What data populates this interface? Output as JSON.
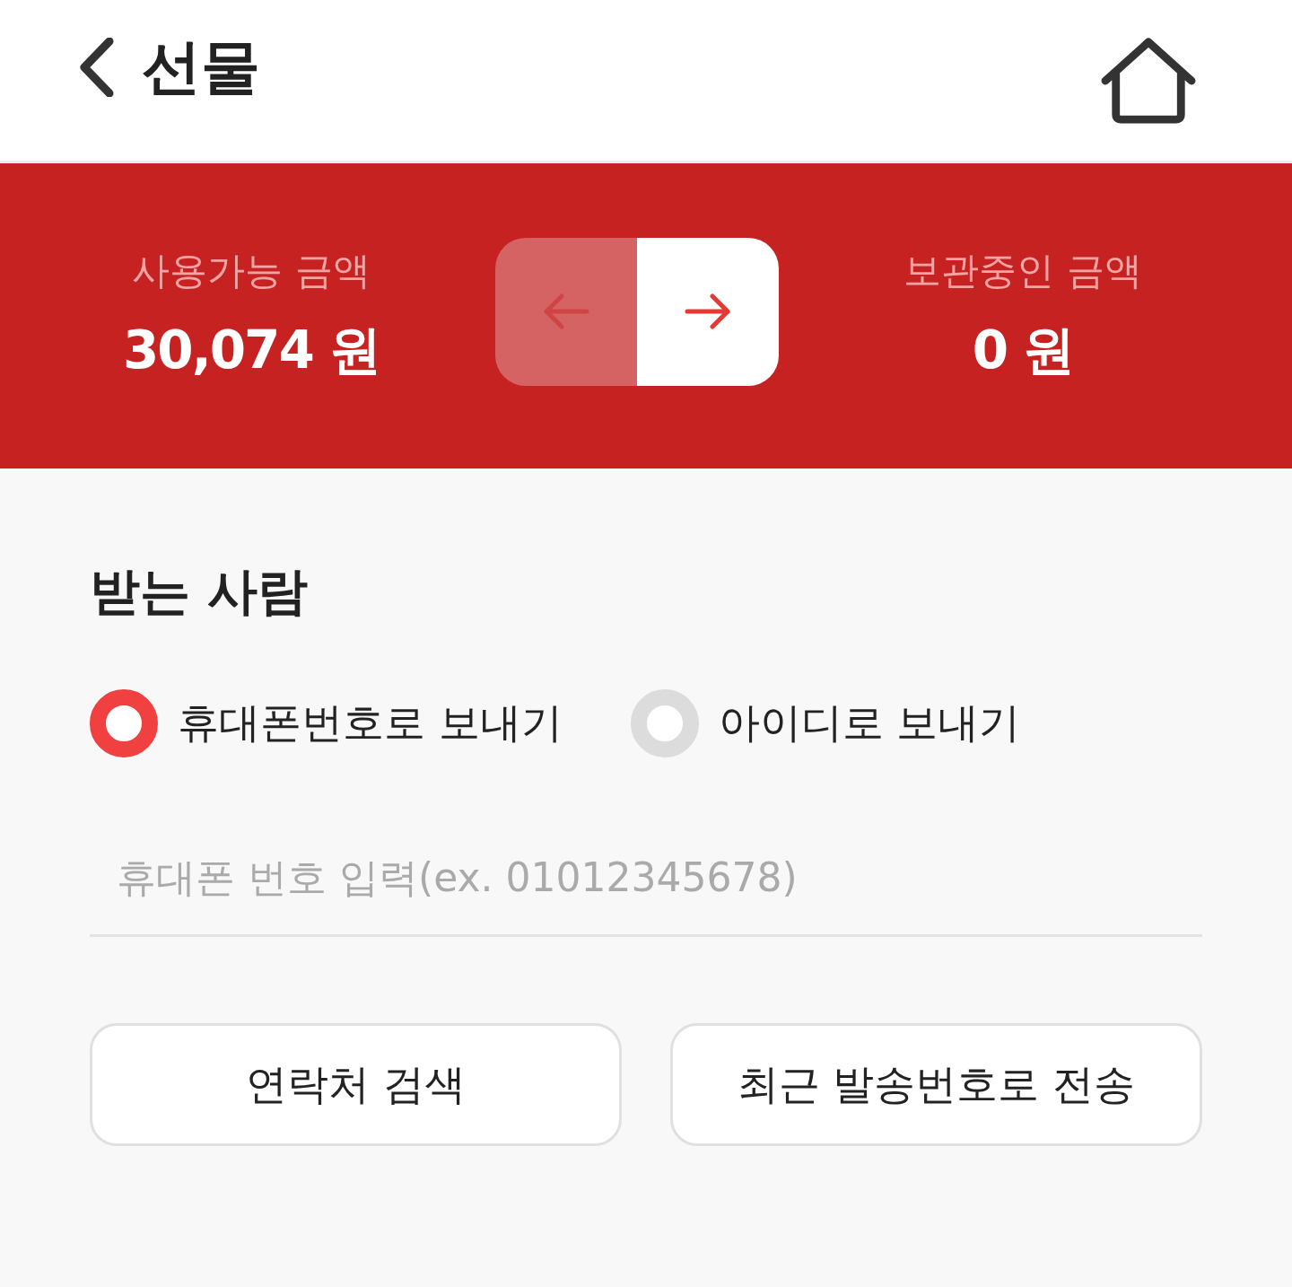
{
  "header": {
    "title": "선물"
  },
  "balance": {
    "available": {
      "label": "사용가능 금액",
      "amount": "30,074 원"
    },
    "toggle": [
      {
        "kind": "left",
        "selected": false
      },
      {
        "kind": "right",
        "selected": true
      }
    ],
    "stored": {
      "label": "보관중인 금액",
      "amount": "0 원"
    }
  },
  "recipient": {
    "title": "받는 사람",
    "options": [
      {
        "label": "휴대폰번호로 보내기",
        "selected": true
      },
      {
        "label": "아이디로 보내기",
        "selected": false
      }
    ],
    "input": {
      "placeholder": "휴대폰 번호 입력(ex. 01012345678)"
    },
    "buttons": [
      "연락처 검색",
      "최근 발송번호로 전송"
    ]
  }
}
